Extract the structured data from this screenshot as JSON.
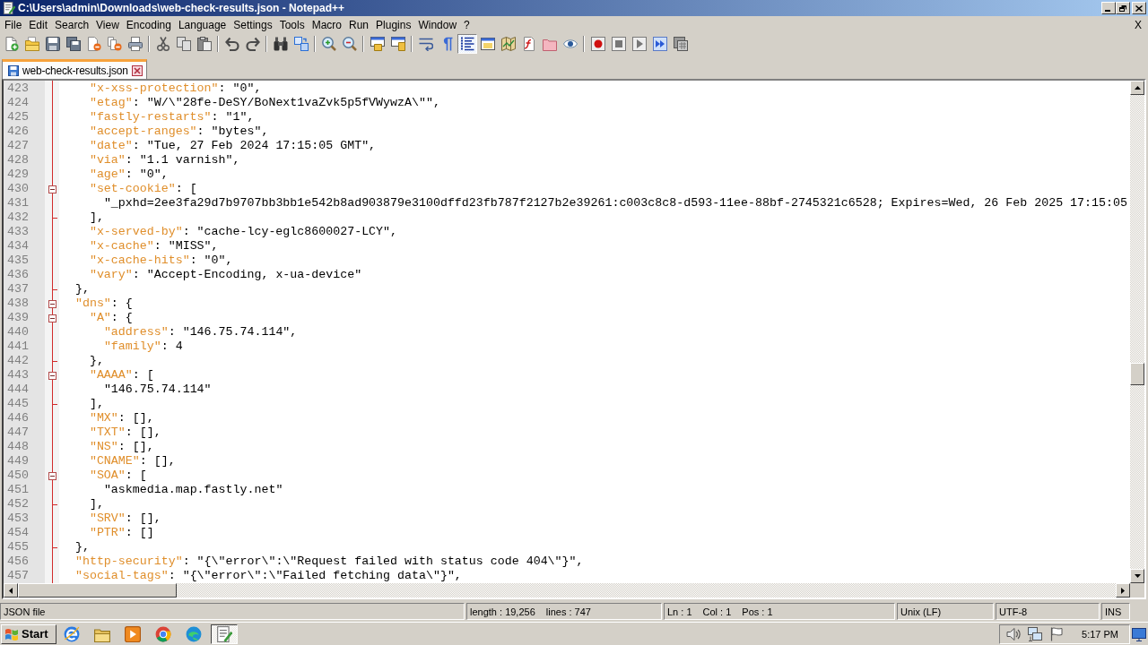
{
  "window": {
    "title": "C:\\Users\\admin\\Downloads\\web-check-results.json - Notepad++"
  },
  "menu": [
    "File",
    "Edit",
    "Search",
    "View",
    "Encoding",
    "Language",
    "Settings",
    "Tools",
    "Macro",
    "Run",
    "Plugins",
    "Window",
    "?"
  ],
  "menu_close": "X",
  "toolbar": [
    {
      "pressed": false
    },
    {
      "pressed": false
    },
    {
      "pressed": false
    },
    {
      "pressed": false
    },
    {
      "pressed": false
    },
    {
      "pressed": false
    },
    {
      "pressed": false
    },
    {
      "pressed": false
    },
    {
      "pressed": false
    },
    {
      "pressed": false
    },
    {
      "pressed": false
    },
    {
      "pressed": false
    },
    {
      "pressed": false
    },
    {
      "pressed": false
    },
    {
      "pressed": false
    },
    {
      "pressed": false
    },
    {
      "pressed": false
    },
    {
      "pressed": false
    },
    {
      "pressed": false
    },
    {
      "pressed": false
    },
    {
      "pressed": true
    },
    {
      "pressed": false
    },
    {
      "pressed": false
    },
    {
      "pressed": false
    },
    {
      "pressed": false
    },
    {
      "pressed": false
    },
    {
      "pressed": false
    },
    {
      "pressed": false
    },
    {
      "pressed": false
    },
    {
      "pressed": false
    },
    {
      "pressed": false
    }
  ],
  "tabs": [
    {
      "label": "web-check-results.json",
      "selected": true
    }
  ],
  "editor": {
    "lines": [
      {
        "number": "423",
        "fold_start": false,
        "fold_end": false,
        "text": "    \"x-xss-protection\": \"0\","
      },
      {
        "number": "424",
        "fold_start": false,
        "fold_end": false,
        "text": "    \"etag\": \"W/\\\"28fe-DeSY/BoNext1vaZvk5p5fVWywzA\\\"\","
      },
      {
        "number": "425",
        "fold_start": false,
        "fold_end": false,
        "text": "    \"fastly-restarts\": \"1\","
      },
      {
        "number": "426",
        "fold_start": false,
        "fold_end": false,
        "text": "    \"accept-ranges\": \"bytes\","
      },
      {
        "number": "427",
        "fold_start": false,
        "fold_end": false,
        "text": "    \"date\": \"Tue, 27 Feb 2024 17:15:05 GMT\","
      },
      {
        "number": "428",
        "fold_start": false,
        "fold_end": false,
        "text": "    \"via\": \"1.1 varnish\","
      },
      {
        "number": "429",
        "fold_start": false,
        "fold_end": false,
        "text": "    \"age\": \"0\","
      },
      {
        "number": "430",
        "fold_start": true,
        "fold_end": false,
        "text": "    \"set-cookie\": ["
      },
      {
        "number": "431",
        "fold_start": false,
        "fold_end": false,
        "text": "      \"_pxhd=2ee3fa29d7b9707bb3bb1e542b8ad903879e3100dffd23fb787f2127b2e39261:c003c8c8-d593-11ee-88bf-2745321c6528; Expires=Wed, 26 Feb 2025 17:15:05"
      },
      {
        "number": "432",
        "fold_start": false,
        "fold_end": true,
        "text": "    ],"
      },
      {
        "number": "433",
        "fold_start": false,
        "fold_end": false,
        "text": "    \"x-served-by\": \"cache-lcy-eglc8600027-LCY\","
      },
      {
        "number": "434",
        "fold_start": false,
        "fold_end": false,
        "text": "    \"x-cache\": \"MISS\","
      },
      {
        "number": "435",
        "fold_start": false,
        "fold_end": false,
        "text": "    \"x-cache-hits\": \"0\","
      },
      {
        "number": "436",
        "fold_start": false,
        "fold_end": false,
        "text": "    \"vary\": \"Accept-Encoding, x-ua-device\""
      },
      {
        "number": "437",
        "fold_start": false,
        "fold_end": true,
        "text": "  },"
      },
      {
        "number": "438",
        "fold_start": true,
        "fold_end": false,
        "text": "  \"dns\": {"
      },
      {
        "number": "439",
        "fold_start": true,
        "fold_end": false,
        "text": "    \"A\": {"
      },
      {
        "number": "440",
        "fold_start": false,
        "fold_end": false,
        "text": "      \"address\": \"146.75.74.114\","
      },
      {
        "number": "441",
        "fold_start": false,
        "fold_end": false,
        "text": "      \"family\": 4"
      },
      {
        "number": "442",
        "fold_start": false,
        "fold_end": true,
        "text": "    },"
      },
      {
        "number": "443",
        "fold_start": true,
        "fold_end": false,
        "text": "    \"AAAA\": ["
      },
      {
        "number": "444",
        "fold_start": false,
        "fold_end": false,
        "text": "      \"146.75.74.114\""
      },
      {
        "number": "445",
        "fold_start": false,
        "fold_end": true,
        "text": "    ],"
      },
      {
        "number": "446",
        "fold_start": false,
        "fold_end": false,
        "text": "    \"MX\": [],"
      },
      {
        "number": "447",
        "fold_start": false,
        "fold_end": false,
        "text": "    \"TXT\": [],"
      },
      {
        "number": "448",
        "fold_start": false,
        "fold_end": false,
        "text": "    \"NS\": [],"
      },
      {
        "number": "449",
        "fold_start": false,
        "fold_end": false,
        "text": "    \"CNAME\": [],"
      },
      {
        "number": "450",
        "fold_start": true,
        "fold_end": false,
        "text": "    \"SOA\": ["
      },
      {
        "number": "451",
        "fold_start": false,
        "fold_end": false,
        "text": "      \"askmedia.map.fastly.net\""
      },
      {
        "number": "452",
        "fold_start": false,
        "fold_end": true,
        "text": "    ],"
      },
      {
        "number": "453",
        "fold_start": false,
        "fold_end": false,
        "text": "    \"SRV\": [],"
      },
      {
        "number": "454",
        "fold_start": false,
        "fold_end": false,
        "text": "    \"PTR\": []"
      },
      {
        "number": "455",
        "fold_start": false,
        "fold_end": true,
        "text": "  },"
      },
      {
        "number": "456",
        "fold_start": false,
        "fold_end": false,
        "text": "  \"http-security\": \"{\\\"error\\\":\\\"Request failed with status code 404\\\"}\","
      },
      {
        "number": "457",
        "fold_start": false,
        "fold_end": false,
        "text": "  \"social-tags\": \"{\\\"error\\\":\\\"Failed fetching data\\\"}\","
      }
    ]
  },
  "status_bar": {
    "file_type": "JSON file",
    "length": "length : 19,256",
    "lines": "lines : 747",
    "ln": "Ln : 1",
    "col": "Col : 1",
    "pos": "Pos : 1",
    "eol": "Unix (LF)",
    "encoding": "UTF-8",
    "mode": "INS"
  },
  "taskbar": {
    "start": "Start",
    "apps": [
      {
        "active": false
      },
      {
        "active": false
      },
      {
        "active": false
      },
      {
        "active": false
      },
      {
        "active": false
      },
      {
        "active": true
      }
    ],
    "clock": "5:17 PM"
  }
}
